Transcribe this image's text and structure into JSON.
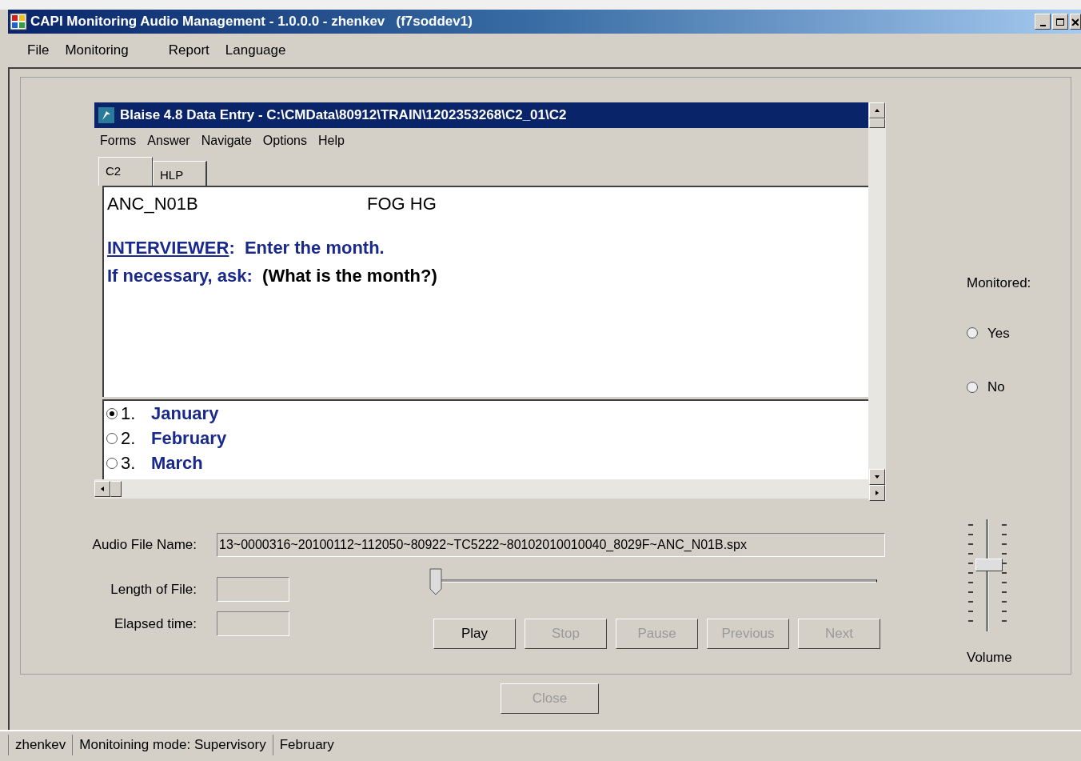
{
  "window": {
    "title": "CAPI Monitoring Audio Management - 1.0.0.0 - zhenkev   (f7soddev1)"
  },
  "menu": [
    "File",
    "Monitoring",
    "Report",
    "Language"
  ],
  "blaise": {
    "title": "Blaise 4.8 Data Entry - C:\\CMData\\80912\\TRAIN\\1202353268\\C2_01\\C2",
    "menu": [
      "Forms",
      "Answer",
      "Navigate",
      "Options",
      "Help"
    ],
    "tabs": [
      {
        "label": "C2",
        "selected": true
      },
      {
        "label": "HLP",
        "selected": false
      }
    ],
    "field_name": "ANC_N01B",
    "field_tag": "FOG HG",
    "instruction": {
      "link": "INTERVIEWER",
      "text": ":  Enter the month."
    },
    "ask": {
      "prompt": "If necessary, ask:",
      "question": "(What is the month?)"
    },
    "answers": [
      {
        "number": "1.",
        "label": "January",
        "selected": true
      },
      {
        "number": "2.",
        "label": "February",
        "selected": false
      },
      {
        "number": "3.",
        "label": "March",
        "selected": false
      }
    ]
  },
  "audio": {
    "file_name_label": "Audio File Name:",
    "file_name": "13~0000316~20100112~112050~80922~TC5222~80102010010040_8029F~ANC_N01B.spx",
    "length_label": "Length of File:",
    "elapsed_label": "Elapsed time:",
    "position": {
      "level": 0
    }
  },
  "buttons": [
    {
      "label": "Play",
      "disabled": false
    },
    {
      "label": "Stop",
      "disabled": true
    },
    {
      "label": "Pause",
      "disabled": true
    },
    {
      "label": "Previous",
      "disabled": true
    },
    {
      "label": "Next",
      "disabled": true
    }
  ],
  "monitored": {
    "label": "Monitored:",
    "options": [
      {
        "label": "Yes",
        "selected": false
      },
      {
        "label": "No",
        "selected": false
      }
    ]
  },
  "volume": {
    "label": "Volume",
    "level": 0.6
  },
  "close_button": {
    "label": "Close",
    "disabled": true
  },
  "status_bar": [
    "zhenkev",
    "Monitoining mode: Supervisory",
    "February"
  ]
}
